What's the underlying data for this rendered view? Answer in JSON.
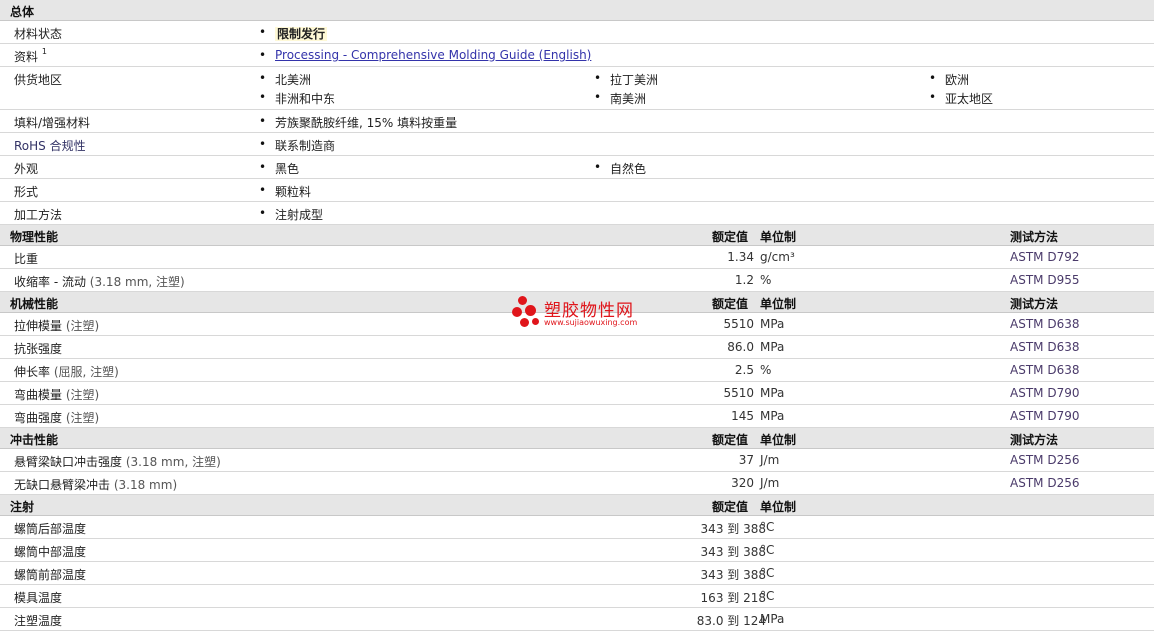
{
  "general": {
    "title": "总体",
    "rows": [
      {
        "label": "材料状态",
        "items": [
          "限制发行"
        ]
      },
      {
        "label": "资料",
        "sup": "1",
        "items": [
          "Processing - Comprehensive Molding Guide (English)"
        ]
      },
      {
        "label": "供货地区",
        "items": [
          "北美洲",
          "拉丁美洲",
          "欧洲",
          "非洲和中东",
          "南美洲",
          "亚太地区"
        ]
      },
      {
        "label": "填料/增强材料",
        "items": [
          "芳族聚酰胺纤维, 15% 填料按重量"
        ]
      },
      {
        "label": "RoHS 合规性",
        "items": [
          "联系制造商"
        ]
      },
      {
        "label": "外观",
        "items": [
          "黑色",
          "自然色"
        ]
      },
      {
        "label": "形式",
        "items": [
          "颗粒料"
        ]
      },
      {
        "label": "加工方法",
        "items": [
          "注射成型"
        ]
      }
    ]
  },
  "headers": {
    "nominal": "额定值",
    "unit": "单位制",
    "test": "测试方法"
  },
  "physical": {
    "title": "物理性能",
    "rows": [
      {
        "label": "比重",
        "value": "1.34",
        "unit": "g/cm³",
        "method": "ASTM D792"
      },
      {
        "label": "收缩率 - 流动",
        "paren": "(3.18 mm, 注塑)",
        "value": "1.2",
        "unit": "%",
        "method": "ASTM D955"
      }
    ]
  },
  "mechanical": {
    "title": "机械性能",
    "rows": [
      {
        "label": "拉伸模量",
        "paren": "(注塑)",
        "value": "5510",
        "unit": "MPa",
        "method": "ASTM D638"
      },
      {
        "label": "抗张强度",
        "value": "86.0",
        "unit": "MPa",
        "method": "ASTM D638"
      },
      {
        "label": "伸长率",
        "paren": "(屈服, 注塑)",
        "value": "2.5",
        "unit": "%",
        "method": "ASTM D638"
      },
      {
        "label": "弯曲模量",
        "paren": "(注塑)",
        "value": "5510",
        "unit": "MPa",
        "method": "ASTM D790"
      },
      {
        "label": "弯曲强度",
        "paren": "(注塑)",
        "value": "145",
        "unit": "MPa",
        "method": "ASTM D790"
      }
    ]
  },
  "impact": {
    "title": "冲击性能",
    "rows": [
      {
        "label": "悬臂梁缺口冲击强度",
        "paren": "(3.18 mm, 注塑)",
        "value": "37",
        "unit": "J/m",
        "method": "ASTM D256"
      },
      {
        "label": "无缺口悬臂梁冲击",
        "paren": "(3.18 mm)",
        "value": "320",
        "unit": "J/m",
        "method": "ASTM D256"
      }
    ]
  },
  "injection": {
    "title": "注射",
    "rows": [
      {
        "label": "螺筒后部温度",
        "value": "343 到  388",
        "unit": "°C"
      },
      {
        "label": "螺筒中部温度",
        "value": "343 到  388",
        "unit": "°C"
      },
      {
        "label": "螺筒前部温度",
        "value": "343 到  388",
        "unit": "°C"
      },
      {
        "label": "模具温度",
        "value": "163 到  218",
        "unit": "°C"
      },
      {
        "label": "注塑温度",
        "value": "83.0 到  124",
        "unit": "MPa"
      }
    ]
  },
  "watermark": {
    "name": "塑胶物性网",
    "url": "www.sujiaowuxing.com",
    "color": "#e0151b"
  }
}
